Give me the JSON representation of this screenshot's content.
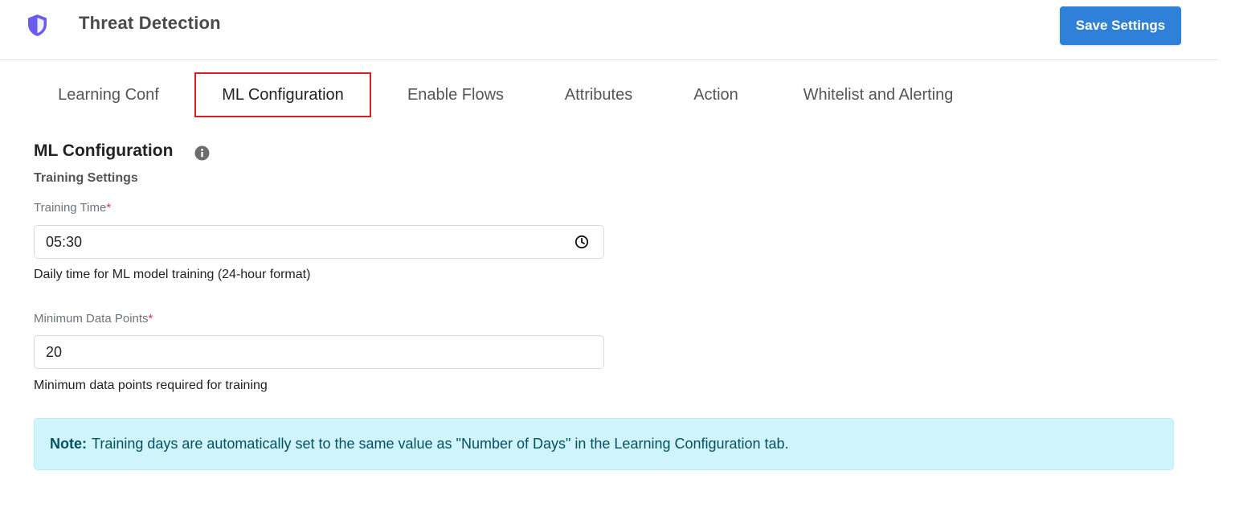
{
  "header": {
    "title": "Threat Detection",
    "save_label": "Save Settings",
    "logo_icon": "shield-icon",
    "accent_color": "#2f80d8"
  },
  "tabs": [
    {
      "label": "Learning Conf",
      "active": false
    },
    {
      "label": "ML Configuration",
      "active": true
    },
    {
      "label": "Enable Flows",
      "active": false
    },
    {
      "label": "Attributes",
      "active": false
    },
    {
      "label": "Action",
      "active": false
    },
    {
      "label": "Whitelist and Alerting",
      "active": false
    }
  ],
  "section": {
    "title": "ML Configuration",
    "info_icon": "info-icon",
    "subheading": "Training Settings"
  },
  "fields": {
    "training_time": {
      "label": "Training Time",
      "required_mark": "*",
      "value": "05:30",
      "help": "Daily time for ML model training (24-hour format)"
    },
    "min_data_points": {
      "label": "Minimum Data Points",
      "required_mark": "*",
      "value": "20",
      "help": "Minimum data points required for training"
    }
  },
  "note": {
    "prefix": "Note:",
    "text": "Training days are automatically set to the same value as \"Number of Days\" in the Learning Configuration tab."
  }
}
